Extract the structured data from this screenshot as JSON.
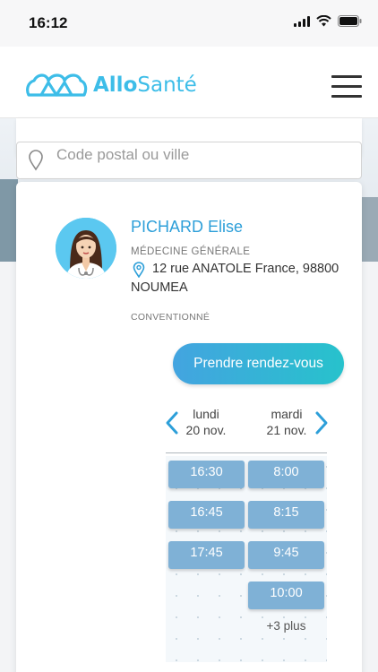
{
  "status_bar": {
    "time": "16:12"
  },
  "header": {
    "logo_part1": "Allo",
    "logo_part2": "Santé",
    "brand_color": "#3dbde8"
  },
  "search": {
    "placeholder": "Code postal ou ville"
  },
  "doctor": {
    "name": "PICHARD Elise",
    "specialty": "MÉDECINE GÉNÉRALE",
    "address": "12 rue ANATOLE France, 98800 NOUMEA",
    "convention": "CONVENTIONNÉ",
    "avatar_bg": "#5bc8f0"
  },
  "booking": {
    "button_label": "Prendre rendez-vous"
  },
  "calendar": {
    "days": [
      {
        "name": "lundi",
        "date": "20 nov.",
        "slots": [
          "16:30",
          "16:45",
          "17:45"
        ]
      },
      {
        "name": "mardi",
        "date": "21 nov.",
        "slots": [
          "8:00",
          "8:15",
          "9:45",
          "10:00"
        ]
      }
    ],
    "more_label": "+3 plus",
    "slot_color": "#7fb1d6"
  }
}
